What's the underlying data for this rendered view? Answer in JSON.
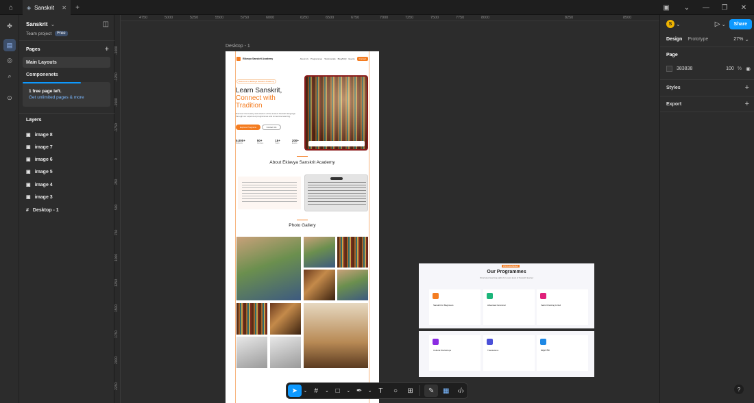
{
  "topbar": {
    "tab_title": "Sanskrit",
    "new_tab": "+"
  },
  "file": {
    "name": "Sanskrit",
    "team": "Team project",
    "plan_badge": "Free"
  },
  "pages": {
    "title": "Pages",
    "add": "+",
    "items": [
      "Main Layouts",
      "Componenets"
    ],
    "notice": {
      "line1": "1 free page left.",
      "line2": "Get unlimited pages & more"
    }
  },
  "layers": {
    "title": "Layers",
    "items": [
      "image 8",
      "image 7",
      "image 6",
      "image 5",
      "image 4",
      "image 3",
      "Desktop - 1"
    ]
  },
  "ruler": {
    "h": [
      "4750",
      "5000",
      "5250",
      "5500",
      "5750",
      "6000",
      "6250",
      "6500",
      "6750",
      "7000",
      "7250",
      "7500",
      "7750",
      "8000",
      "8250",
      "8500"
    ],
    "v": [
      "-1000",
      "-1250",
      "-1500",
      "-1750",
      "0",
      "250",
      "500",
      "750",
      "1000",
      "1250",
      "1500",
      "1750",
      "2000",
      "2250"
    ]
  },
  "frame": {
    "label": "Desktop - 1"
  },
  "site": {
    "brand": "Eklavya Sanskrit Academy",
    "nav": [
      "About Us",
      "Programmes",
      "Testimonials",
      "Blog/FAQ",
      "Events"
    ],
    "nav_cta": "Contact",
    "hero_badge": "Welcome to Eklavya Sanskrit Academy",
    "hero_t1": "Learn Sanskrit,",
    "hero_t2": "Connect with",
    "hero_t3": "Tradition",
    "hero_desc": "Discover the beauty and wisdom of the ancient Sanskrit language through our expert-led programmes and immersive learning.",
    "btn1": "Explore Programs",
    "btn2": "Contact Us",
    "stats": [
      {
        "v": "5,000+",
        "l": "Students"
      },
      {
        "v": "50+",
        "l": "Courses"
      },
      {
        "v": "15+",
        "l": "Years"
      },
      {
        "v": "200+",
        "l": "Events"
      }
    ],
    "about_title": "About Eklavya Sanskrit Academy",
    "gallery_title": "Photo Gallery"
  },
  "programmes": {
    "badge": "PROGRAMMES",
    "title": "Our Programmes",
    "sub": "Structured learning paths for every level of Sanskrit learner",
    "cards": [
      "Sanskrit for Beginners",
      "Advanced Grammar",
      "Vedic Chanting & Ved",
      "Cultural Workshops",
      "Translations",
      "संस्कृत गीता"
    ],
    "card_colors": [
      "#f47c20",
      "#1bb57a",
      "#e0207a",
      "#8a2be2",
      "#4a50d8",
      "#1e88e5"
    ]
  },
  "right": {
    "tab_design": "Design",
    "tab_prototype": "Prototype",
    "zoom": "27%",
    "share": "Share",
    "avatar": "S",
    "page_title": "Page",
    "page_color": "383838",
    "page_opacity": "100",
    "percent": "%",
    "styles": "Styles",
    "export": "Export"
  },
  "help": "?"
}
